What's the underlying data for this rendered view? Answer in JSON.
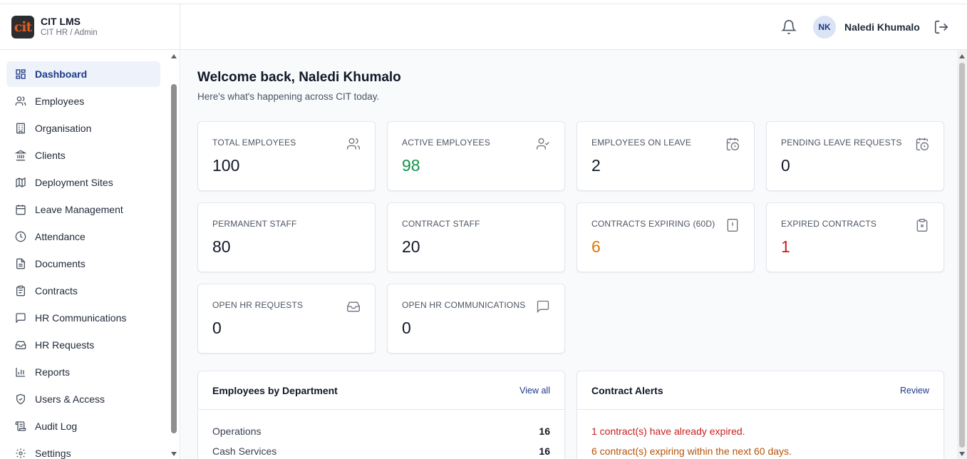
{
  "brand": {
    "title": "CIT LMS",
    "subtitle": "CIT HR / Admin",
    "logo_text": "cit"
  },
  "sidebar": {
    "items": [
      {
        "label": "Dashboard",
        "icon": "dashboard-grid-icon",
        "active": true
      },
      {
        "label": "Employees",
        "icon": "users-icon"
      },
      {
        "label": "Organisation",
        "icon": "building-icon"
      },
      {
        "label": "Clients",
        "icon": "landmark-icon"
      },
      {
        "label": "Deployment Sites",
        "icon": "map-icon"
      },
      {
        "label": "Leave Management",
        "icon": "calendar-icon"
      },
      {
        "label": "Attendance",
        "icon": "clock-icon"
      },
      {
        "label": "Documents",
        "icon": "file-text-icon"
      },
      {
        "label": "Contracts",
        "icon": "clipboard-icon"
      },
      {
        "label": "HR Communications",
        "icon": "message-square-icon"
      },
      {
        "label": "HR Requests",
        "icon": "inbox-icon"
      },
      {
        "label": "Reports",
        "icon": "bar-chart-icon"
      },
      {
        "label": "Users & Access",
        "icon": "shield-icon"
      },
      {
        "label": "Audit Log",
        "icon": "scroll-icon"
      },
      {
        "label": "Settings",
        "icon": "gear-icon"
      }
    ]
  },
  "header": {
    "avatar_initials": "NK",
    "user_name": "Naledi Khumalo"
  },
  "main": {
    "welcome_title": "Welcome back, Naledi Khumalo",
    "welcome_subtitle": "Here's what's happening across CIT today.",
    "stats": [
      {
        "label": "TOTAL EMPLOYEES",
        "value": "100",
        "icon": "users-icon",
        "color": "#111827"
      },
      {
        "label": "ACTIVE EMPLOYEES",
        "value": "98",
        "icon": "user-check-icon",
        "color": "#15924b"
      },
      {
        "label": "EMPLOYEES ON LEAVE",
        "value": "2",
        "icon": "calendar-clock-icon",
        "color": "#111827"
      },
      {
        "label": "PENDING LEAVE REQUESTS",
        "value": "0",
        "icon": "calendar-clock-icon",
        "color": "#111827"
      },
      {
        "label": "PERMANENT STAFF",
        "value": "80",
        "icon": "",
        "color": "#111827"
      },
      {
        "label": "CONTRACT STAFF",
        "value": "20",
        "icon": "",
        "color": "#111827"
      },
      {
        "label": "CONTRACTS EXPIRING (60D)",
        "value": "6",
        "icon": "file-alert-icon",
        "color": "#d97706"
      },
      {
        "label": "EXPIRED CONTRACTS",
        "value": "1",
        "icon": "clipboard-x-icon",
        "color": "#c81e1e"
      },
      {
        "label": "OPEN HR REQUESTS",
        "value": "0",
        "icon": "inbox-icon",
        "color": "#111827"
      },
      {
        "label": "OPEN HR COMMUNICATIONS",
        "value": "0",
        "icon": "message-square-icon",
        "color": "#111827"
      }
    ],
    "departments": {
      "title": "Employees by Department",
      "link": "View all",
      "rows": [
        {
          "name": "Operations",
          "count": "16"
        },
        {
          "name": "Cash Services",
          "count": "16"
        }
      ]
    },
    "contract_alerts": {
      "title": "Contract Alerts",
      "link": "Review",
      "alerts": [
        {
          "text": "1 contract(s) have already expired.",
          "color": "#c81e1e"
        },
        {
          "text": "6 contract(s) expiring within the next 60 days.",
          "color": "#b45309"
        }
      ]
    }
  },
  "colors": {
    "accent": "#1e3a8a",
    "active_bg": "#eef2fa",
    "page_bg": "#f8fafc"
  }
}
